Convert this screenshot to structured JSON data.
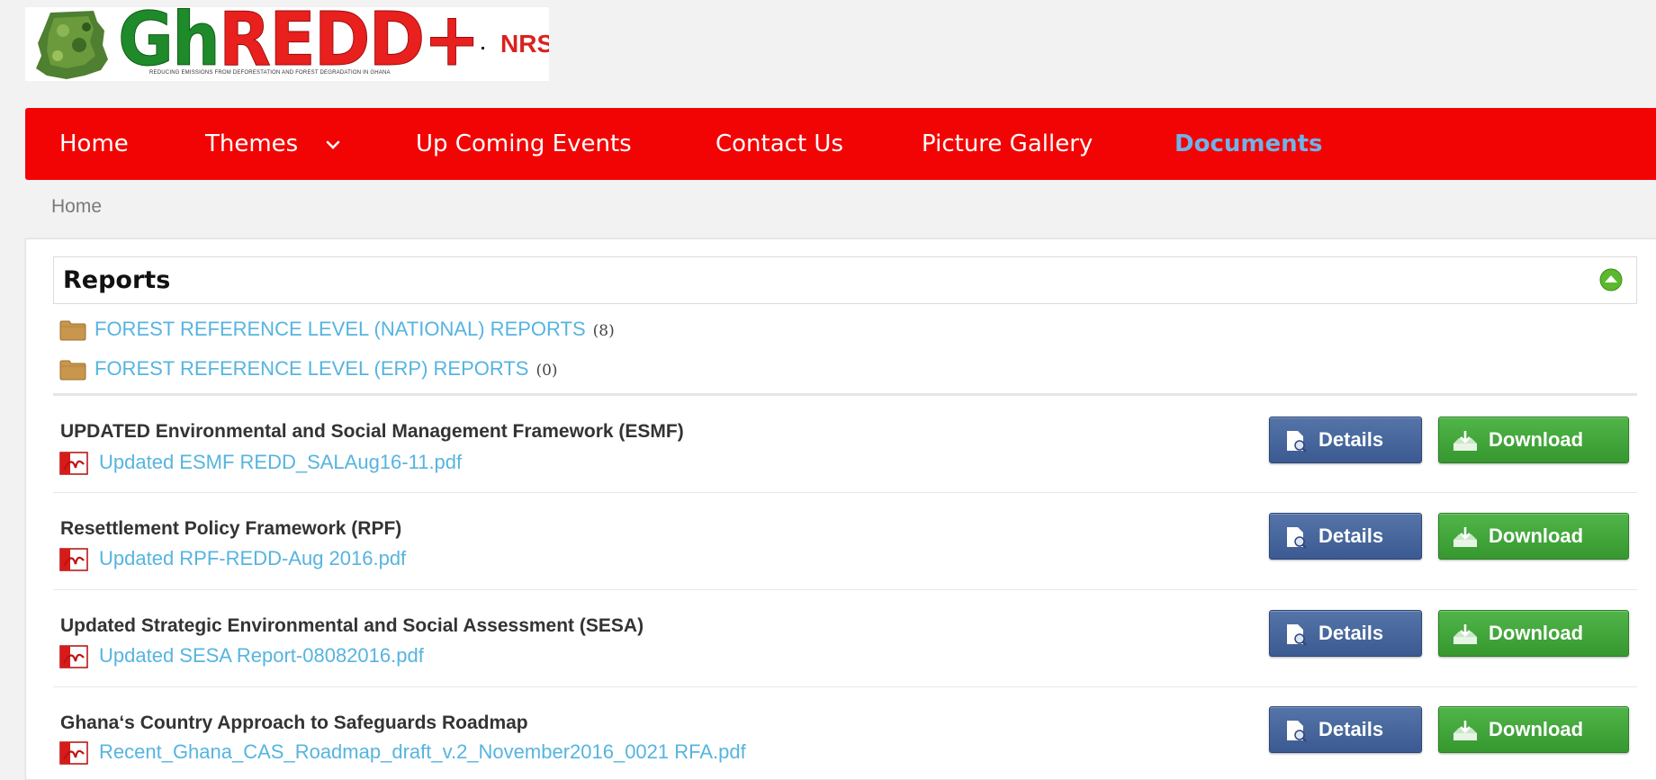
{
  "logo": {
    "text_gh": "Gh",
    "text_redd": "REDD+",
    "suffix": "NRS",
    "tagline": "REDUCING EMISSIONS FROM DEFORESTATION AND FOREST DEGRADATION IN GHANA"
  },
  "nav": {
    "items": [
      {
        "label": "Home"
      },
      {
        "label": "Themes"
      },
      {
        "label": "Up Coming Events"
      },
      {
        "label": "Contact Us"
      },
      {
        "label": "Picture Gallery"
      },
      {
        "label": "Documents",
        "active": true
      }
    ]
  },
  "breadcrumb": "Home",
  "section": {
    "title": "Reports",
    "categories": [
      {
        "label": "FOREST REFERENCE LEVEL (NATIONAL) REPORTS",
        "count": "(8)"
      },
      {
        "label": "FOREST REFERENCE LEVEL (ERP) REPORTS",
        "count": "(0)"
      }
    ]
  },
  "documents": [
    {
      "title": "UPDATED Environmental and Social Management Framework (ESMF)",
      "file": "Updated ESMF REDD_SALAug16-11.pdf"
    },
    {
      "title": "Resettlement Policy Framework (RPF)",
      "file": "Updated RPF-REDD-Aug 2016.pdf"
    },
    {
      "title": "Updated Strategic Environmental and Social Assessment (SESA)",
      "file": "Updated SESA Report-08082016.pdf"
    },
    {
      "title": "Ghana‘s Country Approach to Safeguards Roadmap",
      "file": "Recent_Ghana_CAS_Roadmap_draft_v.2_November2016_0021 RFA.pdf"
    }
  ],
  "buttons": {
    "details": "Details",
    "download": "Download"
  },
  "colors": {
    "nav_bg": "#f30404",
    "nav_active": "#6fb3e8",
    "link": "#56b4e0",
    "details_btn": "#3b5a92",
    "download_btn": "#3aa033"
  },
  "icons": {
    "themes_dropdown": "chevron-down-icon",
    "collapse": "collapse-up-icon",
    "category": "folder-icon",
    "file": "pdf-icon",
    "details": "document-search-icon",
    "download": "download-tray-icon"
  }
}
